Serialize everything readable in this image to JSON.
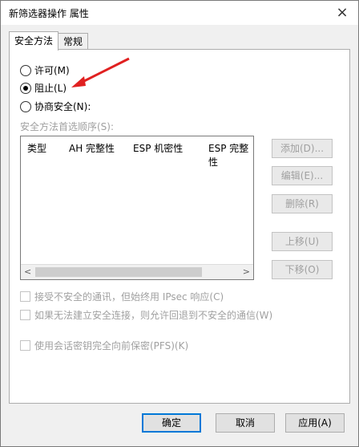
{
  "window": {
    "title": "新筛选器操作 属性",
    "close_glyph": "×"
  },
  "tabs": [
    {
      "label": "安全方法"
    },
    {
      "label": "常规"
    }
  ],
  "radios": [
    {
      "label": "许可(M)",
      "checked": false
    },
    {
      "label": "阻止(L)",
      "checked": true
    },
    {
      "label": "协商安全(N):",
      "checked": false
    }
  ],
  "security_order_label": "安全方法首选顺序(S):",
  "table": {
    "columns": [
      "类型",
      "AH 完整性",
      "ESP 机密性",
      "ESP 完整性"
    ],
    "scroll_left": "<",
    "scroll_right": ">"
  },
  "side_buttons": [
    "添加(D)...",
    "编辑(E)...",
    "删除(R)",
    "上移(U)",
    "下移(O)"
  ],
  "checkboxes": [
    "接受不安全的通讯，但始终用 IPsec 响应(C)",
    "如果无法建立安全连接，则允许回退到不安全的通信(W)",
    "使用会话密钥完全向前保密(PFS)(K)"
  ],
  "footer": {
    "ok": "确定",
    "cancel": "取消",
    "apply": "应用(A)"
  },
  "colors": {
    "accent": "#0078d7",
    "arrow": "#e02020"
  }
}
